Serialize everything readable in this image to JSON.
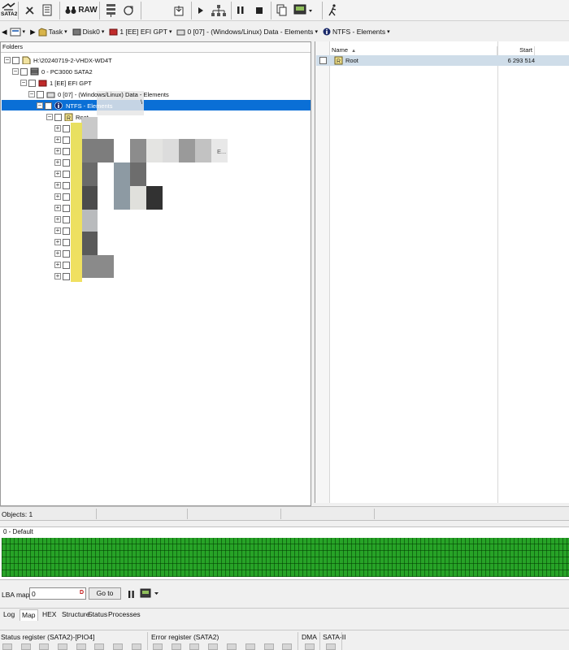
{
  "toolbar": {
    "logo_label": "SATA2",
    "raw_label": "RAW",
    "icons": [
      "tools-icon",
      "script-icon",
      "binoculars-icon",
      "raw-button",
      "hdd-stack-icon",
      "refresh-icon",
      "export-icon",
      "play-icon",
      "tree-icon",
      "pause-icon",
      "stop-icon",
      "copy-icon",
      "monitor-icon",
      "run-icon"
    ]
  },
  "breadcrumb": {
    "items": [
      {
        "label": "Task",
        "icon": "task-icon"
      },
      {
        "label": "Disk0",
        "icon": "disk-icon"
      },
      {
        "label": "1 [EE] EFI GPT",
        "icon": "partition-icon"
      },
      {
        "label": "0 [07] - (Windows/Linux) Data - Elements",
        "icon": "drive-icon"
      },
      {
        "label": "NTFS - Elements",
        "icon": "info-icon"
      }
    ]
  },
  "folders": {
    "header": "Folders",
    "tree": [
      {
        "label": "H:\\20240719-2-VHDX-WD4T",
        "extra": "\\"
      },
      {
        "label": "0 - PC3000 SATA2"
      },
      {
        "label": "1 [EE] EFI GPT"
      },
      {
        "label": "0 [07] - (Windows/Linux) Data - Elements"
      },
      {
        "label": "NTFS - Elements"
      },
      {
        "label": "Root"
      }
    ],
    "child_fragment": "E..."
  },
  "filelist": {
    "columns": {
      "name": "Name",
      "start": "Start"
    },
    "rows": [
      {
        "name": "Root",
        "start": "6 293 514"
      }
    ]
  },
  "status": {
    "objects": "Objects: 1"
  },
  "map": {
    "title": "0 - Default",
    "fill_color": "#27a327"
  },
  "lba": {
    "label": "LBA map",
    "value": "0",
    "dec_label": "D",
    "goto_label": "Go to"
  },
  "tabs": {
    "items": [
      "Log",
      "Map",
      "HEX",
      "Structure",
      "Status",
      "Processes"
    ],
    "active": "Map"
  },
  "registers": {
    "status_label": "Status register (SATA2)-[PIO4]",
    "error_label": "Error register (SATA2)",
    "dma_label": "DMA",
    "sata_label": "SATA-II"
  },
  "colors": {
    "selection": "#0a6fd6",
    "map_green": "#27a327"
  }
}
